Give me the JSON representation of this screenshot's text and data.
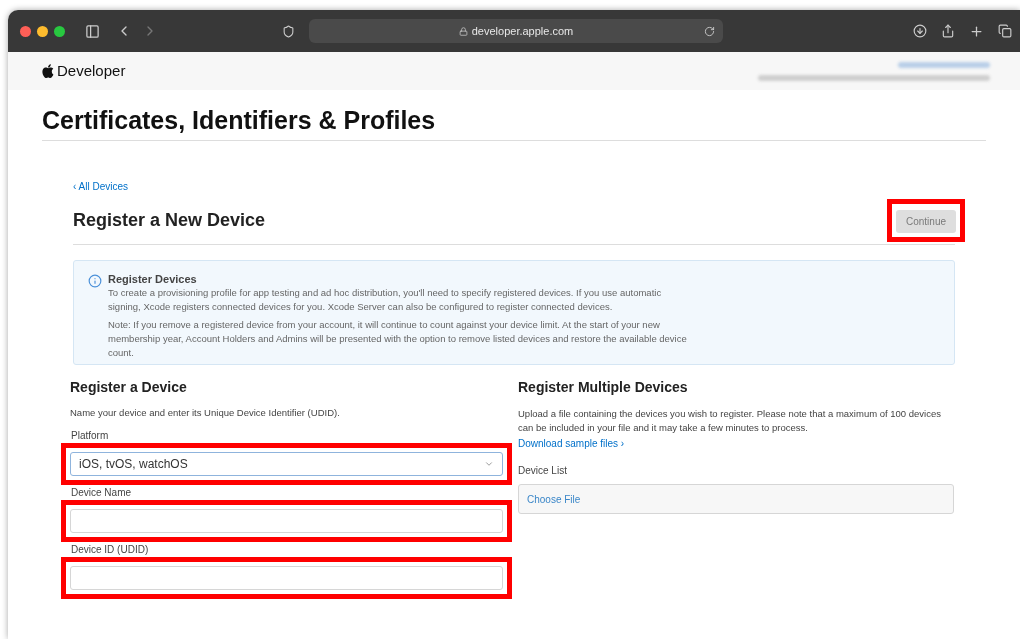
{
  "browser": {
    "url": "developer.apple.com"
  },
  "header": {
    "brand": "Developer"
  },
  "title": "Certificates, Identifiers & Profiles",
  "back_link": "‹ All Devices",
  "heading": "Register a New Device",
  "continue_button": {
    "label": "Continue",
    "disabled": true
  },
  "info": {
    "title": "Register Devices",
    "paragraphs": [
      "To create a provisioning profile for app testing and ad hoc distribution, you'll need to specify registered devices. If you use automatic signing, Xcode registers connected devices for you. Xcode Server can also be configured to register connected devices.",
      "Note: If you remove a registered device from your account, it will continue to count against your device limit. At the start of your new membership year, Account Holders and Admins will be presented with the option to remove listed devices and restore the available device count."
    ]
  },
  "single": {
    "heading": "Register a Device",
    "description": "Name your device and enter its Unique Device Identifier (UDID).",
    "fields": [
      {
        "kind": "select",
        "label": "Platform",
        "value": "iOS, tvOS, watchOS"
      },
      {
        "kind": "text",
        "label": "Device Name"
      },
      {
        "kind": "text",
        "label": "Device ID (UDID)"
      }
    ]
  },
  "multiple": {
    "heading": "Register Multiple Devices",
    "description": "Upload a file containing the devices you wish to register. Please note that a maximum of 100 devices can be included in your file and it may take a few minutes to process.",
    "link": "Download sample files ›",
    "file_label": "Device List",
    "file_button": "Choose File"
  }
}
